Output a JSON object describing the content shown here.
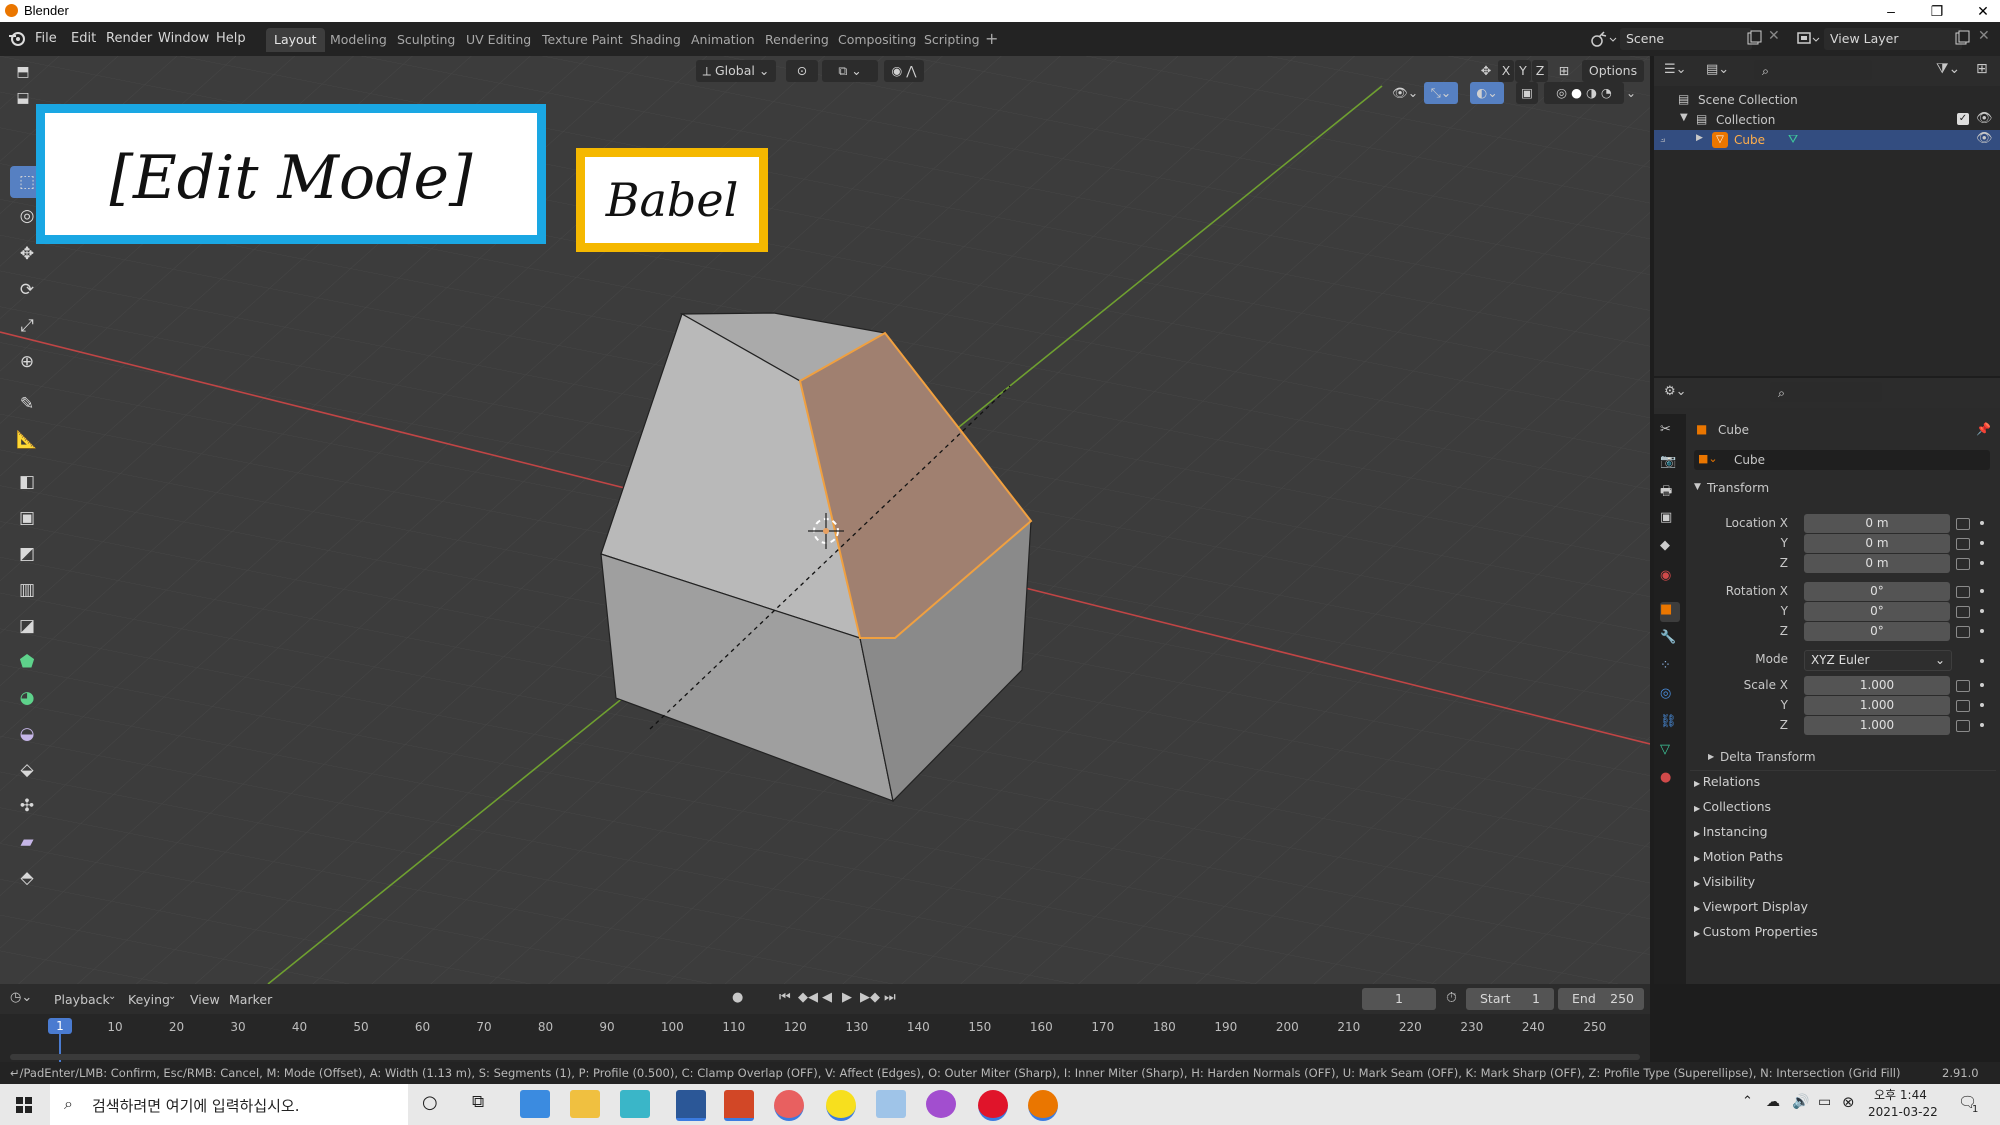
{
  "window": {
    "title": "Blender",
    "controls": [
      "–",
      "❐",
      "✕"
    ]
  },
  "menu": {
    "items": [
      "File",
      "Edit",
      "Render",
      "Window",
      "Help"
    ]
  },
  "workspaces": [
    "Layout",
    "Modeling",
    "Sculpting",
    "UV Editing",
    "Texture Paint",
    "Shading",
    "Animation",
    "Rendering",
    "Compositing",
    "Scripting"
  ],
  "active_workspace": "Layout",
  "scene": {
    "name": "Scene",
    "view_layer": "View Layer"
  },
  "viewport": {
    "orientation": "Global",
    "axis_labels": [
      "X",
      "Y",
      "Z"
    ],
    "options_label": "Options",
    "overlay_edit_label": "[Edit Mode]",
    "overlay_babel_label": "Babel",
    "colors": {
      "background": "#3c3c3c",
      "x_axis": "#c04545",
      "y_axis": "#6fa030",
      "selected_face": "#a08070",
      "selected_edge": "#f0a040",
      "face_light": "#b9b9b9",
      "face_mid": "#9f9f9f",
      "face_dark": "#8a8a8a"
    }
  },
  "tools": [
    "select-box-icon",
    "cursor-icon",
    "move-icon",
    "rotate-icon",
    "scale-icon",
    "transform-icon",
    "annotate-icon",
    "measure-icon",
    "extrude-icon",
    "inset-icon",
    "bevel-icon",
    "loop-cut-icon",
    "knife-icon",
    "poly-build-icon",
    "spin-icon",
    "smooth-icon",
    "edge-slide-icon",
    "shrink-icon",
    "shear-icon",
    "rip-icon"
  ],
  "outliner": {
    "root": "Scene Collection",
    "collection": "Collection",
    "object": "Cube"
  },
  "properties": {
    "object_name": "Cube",
    "datablock_name": "Cube",
    "transform_title": "Transform",
    "location": {
      "label": "Location X",
      "x": "0 m",
      "y": "0 m",
      "z": "0 m"
    },
    "rotation": {
      "label": "Rotation X",
      "x": "0°",
      "y": "0°",
      "z": "0°"
    },
    "mode_label": "Mode",
    "mode_value": "XYZ Euler",
    "scale": {
      "label": "Scale X",
      "x": "1.000",
      "y": "1.000",
      "z": "1.000"
    },
    "axis_y": "Y",
    "axis_z": "Z",
    "delta_transform": "Delta Transform",
    "sections": [
      "Relations",
      "Collections",
      "Instancing",
      "Motion Paths",
      "Visibility",
      "Viewport Display",
      "Custom Properties"
    ]
  },
  "timeline": {
    "menus": [
      "Playback",
      "Keying",
      "View",
      "Marker"
    ],
    "current_frame": "1",
    "start_label": "Start",
    "start_value": "1",
    "end_label": "End",
    "end_value": "250",
    "ticks": [
      "1",
      "10",
      "20",
      "30",
      "40",
      "50",
      "60",
      "70",
      "80",
      "90",
      "100",
      "110",
      "120",
      "130",
      "140",
      "150",
      "160",
      "170",
      "180",
      "190",
      "200",
      "210",
      "220",
      "230",
      "240",
      "250"
    ]
  },
  "status": {
    "hint": "↵/PadEnter/LMB: Confirm, Esc/RMB: Cancel, M: Mode (Offset), A: Width (1.13 m), S: Segments (1), P: Profile (0.500), C: Clamp Overlap (OFF), V: Affect (Edges), O: Outer Miter (Sharp), I: Inner Miter (Sharp), H: Harden Normals (OFF), U: Mark Seam (OFF), K: Mark Sharp (OFF), Z: Profile Type (Superellipse), N: Intersection (Grid Fill)",
    "version": "2.91.0"
  },
  "taskbar": {
    "search_placeholder": "검색하려면 여기에 입력하십시오.",
    "time": "오후 1:44",
    "date": "2021-03-22",
    "notif_count": "1"
  }
}
